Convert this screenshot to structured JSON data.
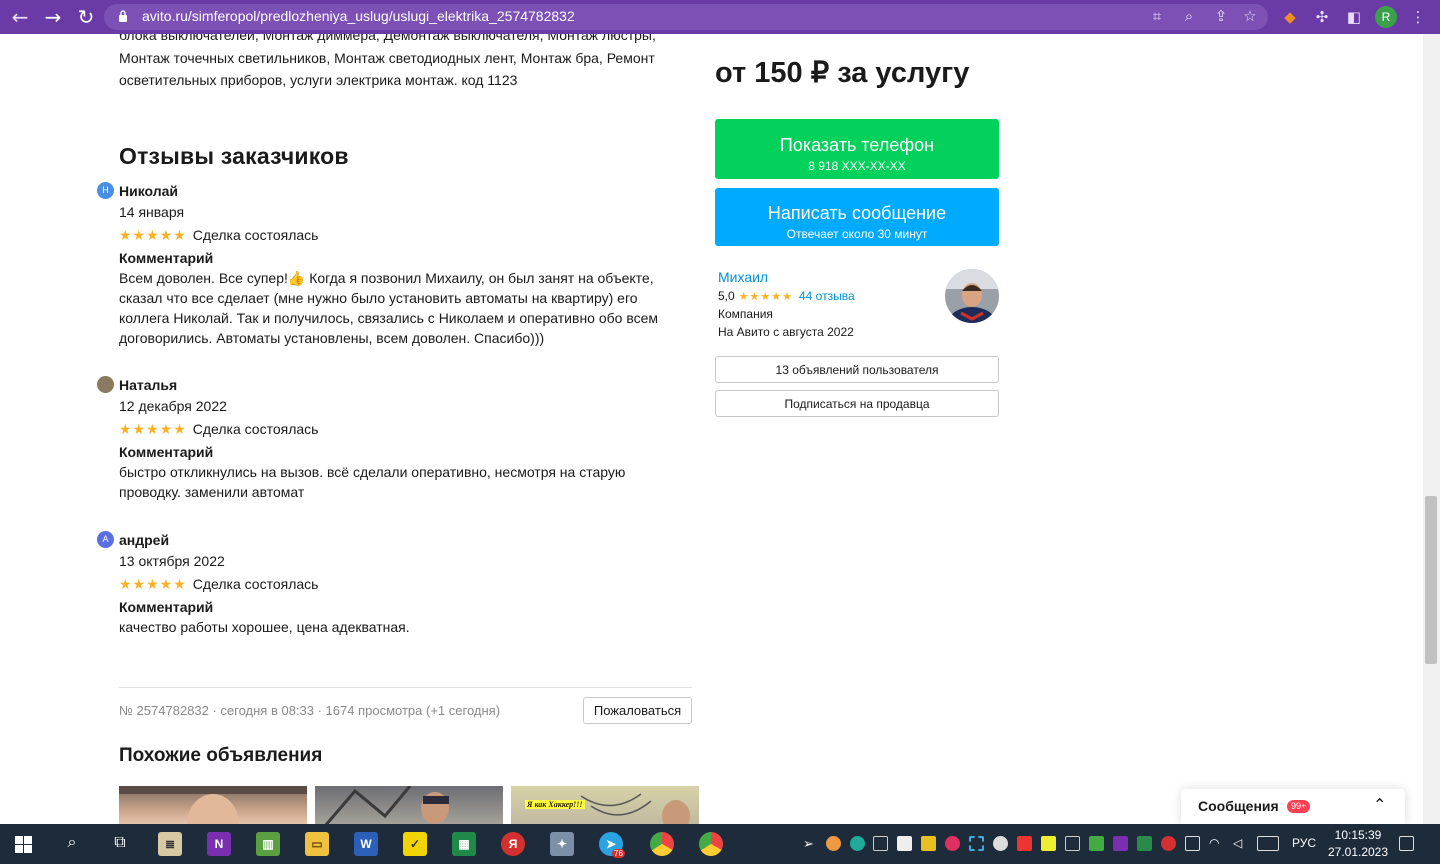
{
  "browser": {
    "url": "avito.ru/simferopol/predlozheniya_uslug/uslugi_elektrika_2574782832",
    "profile_initial": "R"
  },
  "description": {
    "text": "блока выключателей, Монтаж диммера, Демонтаж выключателя, Монтаж люстры, Монтаж точечных светильников, Монтаж светодиодных лент, Монтаж бра, Ремонт осветительных приборов, услуги электрика монтаж. код 1123"
  },
  "reviews": {
    "heading": "Отзывы заказчиков",
    "comment_label": "Комментарий",
    "items": [
      {
        "avatar_letter": "Н",
        "avatar_color": "#4a90e2",
        "name": "Николай",
        "date": "14 января",
        "stars": 5,
        "status": "Сделка состоялась",
        "comment": "Всем доволен. Все супер!👍 Когда я позвонил Михаилу, он был занят на объекте, сказал что все сделает (мне нужно было установить автоматы на квартиру) его коллега Николай. Так и получилось, связались с Николаем и оперативно обо всем договорились. Автоматы установлены, всем доволен. Спасибо)))"
      },
      {
        "avatar_letter": "",
        "avatar_color": "#8a7a60",
        "name": "Наталья",
        "date": "12 декабря 2022",
        "stars": 5,
        "status": "Сделка состоялась",
        "comment": "быстро откликнулись на вызов. всё сделали оперативно, несмотря на старую проводку. заменили автомат"
      },
      {
        "avatar_letter": "А",
        "avatar_color": "#5a6fe0",
        "name": "андрей",
        "date": "13 октября 2022",
        "stars": 5,
        "status": "Сделка состоялась",
        "comment": "качество работы хорошее, цена адекватная."
      }
    ]
  },
  "listing_meta": {
    "text": "№ 2574782832 · сегодня в 08:33 · 1674 просмотра (+1 сегодня)",
    "complain_label": "Пожаловаться"
  },
  "similar": {
    "heading": "Похожие объявления",
    "thumb_caption": "Я как Хаккер!!!"
  },
  "sidebar": {
    "price": "от 150 ₽ за услугу",
    "phone_button": {
      "label": "Показать телефон",
      "sub": "8 918 XXX-XX-XX"
    },
    "message_button": {
      "label": "Написать сообщение",
      "sub": "Отвечает около 30 минут"
    },
    "seller": {
      "name": "Михаил",
      "rating": "5,0",
      "stars": 5,
      "reviews": "44 отзыва",
      "type": "Компания",
      "since": "На Авито с августа 2022"
    },
    "ads_button": "13 объявлений пользователя",
    "subscribe_button": "Подписаться на продавца"
  },
  "messages_widget": {
    "label": "Сообщения",
    "badge": "99+"
  },
  "taskbar": {
    "language": "РУС",
    "time": "10:15:39",
    "date": "27.01.2023",
    "telegram_badge": "76"
  },
  "colors": {
    "browser_frame": "#6a3aa6",
    "avito_green": "#02d15c",
    "avito_blue": "#00aaff",
    "star": "#ffb021",
    "link": "#0091d9"
  }
}
